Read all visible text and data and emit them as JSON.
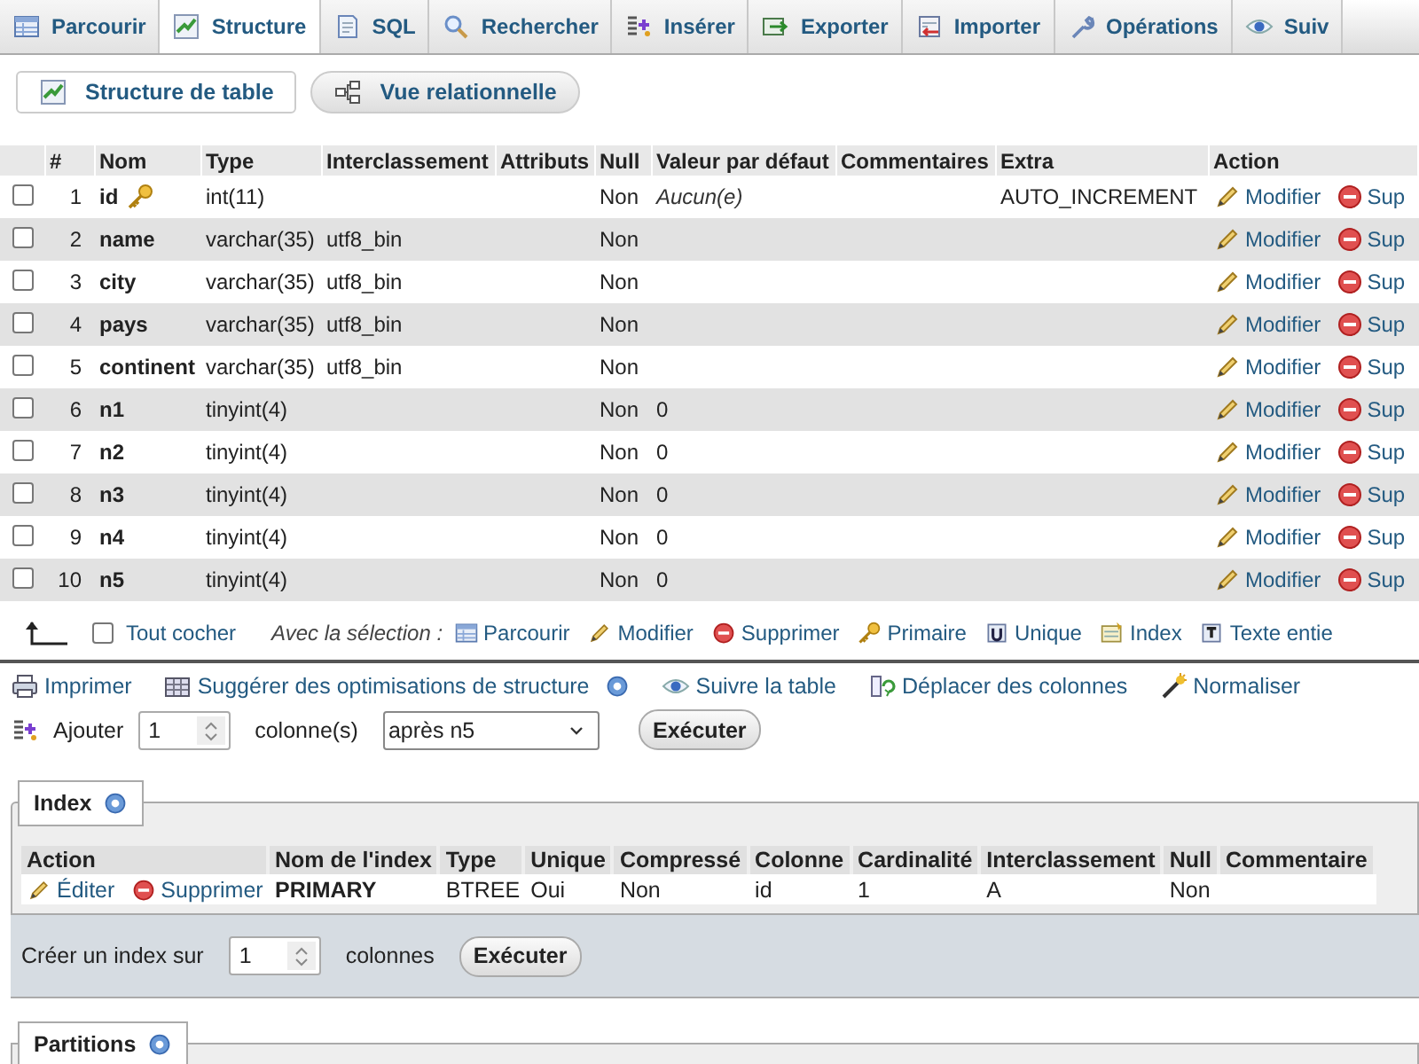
{
  "tabs": [
    {
      "label": "Parcourir",
      "kind": "browse",
      "selected": false
    },
    {
      "label": "Structure",
      "kind": "structure",
      "selected": true
    },
    {
      "label": "SQL",
      "kind": "sql",
      "selected": false
    },
    {
      "label": "Rechercher",
      "kind": "search",
      "selected": false
    },
    {
      "label": "Insérer",
      "kind": "insert",
      "selected": false
    },
    {
      "label": "Exporter",
      "kind": "export",
      "selected": false
    },
    {
      "label": "Importer",
      "kind": "import",
      "selected": false
    },
    {
      "label": "Opérations",
      "kind": "wrench",
      "selected": false
    },
    {
      "label": "Suiv",
      "kind": "eye",
      "selected": false
    }
  ],
  "subnav": [
    {
      "label": "Structure de table",
      "kind": "structure",
      "selected": true
    },
    {
      "label": "Vue relationnelle",
      "kind": "relation",
      "selected": false
    }
  ],
  "structure_table": {
    "columns": [
      "#",
      "Nom",
      "Type",
      "Interclassement",
      "Attributs",
      "Null",
      "Valeur par défaut",
      "Commentaires",
      "Extra",
      "Action"
    ],
    "rows": [
      {
        "checked": false,
        "number": "1",
        "name": "id",
        "primary": true,
        "type": "int(11)",
        "collation": "",
        "null": "Non",
        "default": "Aucun(e)",
        "default_none": true,
        "extra": "AUTO_INCREMENT",
        "actions": [
          "Modifier",
          "Sup"
        ]
      },
      {
        "checked": false,
        "number": "2",
        "name": "name",
        "primary": false,
        "type": "varchar(35)",
        "collation": "utf8_bin",
        "null": "Non",
        "default": "",
        "default_none": false,
        "extra": "",
        "actions": [
          "Modifier",
          "Sup"
        ]
      },
      {
        "checked": false,
        "number": "3",
        "name": "city",
        "primary": false,
        "type": "varchar(35)",
        "collation": "utf8_bin",
        "null": "Non",
        "default": "",
        "default_none": false,
        "extra": "",
        "actions": [
          "Modifier",
          "Sup"
        ]
      },
      {
        "checked": false,
        "number": "4",
        "name": "pays",
        "primary": false,
        "type": "varchar(35)",
        "collation": "utf8_bin",
        "null": "Non",
        "default": "",
        "default_none": false,
        "extra": "",
        "actions": [
          "Modifier",
          "Sup"
        ]
      },
      {
        "checked": false,
        "number": "5",
        "name": "continent",
        "primary": false,
        "type": "varchar(35)",
        "collation": "utf8_bin",
        "null": "Non",
        "default": "",
        "default_none": false,
        "extra": "",
        "actions": [
          "Modifier",
          "Sup"
        ]
      },
      {
        "checked": false,
        "number": "6",
        "name": "n1",
        "primary": false,
        "type": "tinyint(4)",
        "collation": "",
        "null": "Non",
        "default": "0",
        "default_none": false,
        "extra": "",
        "actions": [
          "Modifier",
          "Sup"
        ]
      },
      {
        "checked": false,
        "number": "7",
        "name": "n2",
        "primary": false,
        "type": "tinyint(4)",
        "collation": "",
        "null": "Non",
        "default": "0",
        "default_none": false,
        "extra": "",
        "actions": [
          "Modifier",
          "Sup"
        ]
      },
      {
        "checked": false,
        "number": "8",
        "name": "n3",
        "primary": false,
        "type": "tinyint(4)",
        "collation": "",
        "null": "Non",
        "default": "0",
        "default_none": false,
        "extra": "",
        "actions": [
          "Modifier",
          "Sup"
        ]
      },
      {
        "checked": false,
        "number": "9",
        "name": "n4",
        "primary": false,
        "type": "tinyint(4)",
        "collation": "",
        "null": "Non",
        "default": "0",
        "default_none": false,
        "extra": "",
        "actions": [
          "Modifier",
          "Sup"
        ]
      },
      {
        "checked": false,
        "number": "10",
        "name": "n5",
        "primary": false,
        "type": "tinyint(4)",
        "collation": "",
        "null": "Non",
        "default": "0",
        "default_none": false,
        "extra": "",
        "actions": [
          "Modifier",
          "Sup"
        ]
      }
    ]
  },
  "bulk": {
    "check_all": {
      "label": "Tout cocher",
      "checked": false
    },
    "with_selection": "Avec la sélection :",
    "actions": [
      {
        "label": "Parcourir",
        "kind": "browse"
      },
      {
        "label": "Modifier",
        "kind": "pencil"
      },
      {
        "label": "Supprimer",
        "kind": "delete"
      },
      {
        "label": "Primaire",
        "kind": "key"
      },
      {
        "label": "Unique",
        "kind": "unique"
      },
      {
        "label": "Index",
        "kind": "index"
      },
      {
        "label": "Texte entie",
        "kind": "fulltext"
      }
    ]
  },
  "toolbar": [
    {
      "label": "Imprimer",
      "kind": "print",
      "help": false
    },
    {
      "label": "Suggérer des optimisations de structure",
      "kind": "optimize",
      "help": true
    },
    {
      "label": "Suivre la table",
      "kind": "eye",
      "help": false
    },
    {
      "label": "Déplacer des colonnes",
      "kind": "move",
      "help": false
    },
    {
      "label": "Normaliser",
      "kind": "wand",
      "help": false
    }
  ],
  "add_column": {
    "label": "Ajouter",
    "count": "1",
    "unit": "colonne(s)",
    "position": "après n5",
    "button": "Exécuter"
  },
  "index": {
    "legend": "Index",
    "action_header": "Action",
    "columns": [
      "Nom de l'index",
      "Type",
      "Unique",
      "Compressé",
      "Colonne",
      "Cardinalité",
      "Interclassement",
      "Null",
      "Commentaire"
    ],
    "rows": [
      {
        "actions": [
          "Éditer",
          "Supprimer"
        ],
        "cells": [
          "PRIMARY",
          "BTREE",
          "Oui",
          "Non",
          "id",
          "1",
          "A",
          "Non"
        ]
      }
    ],
    "create": {
      "label": "Créer un index sur",
      "count": "1",
      "unit": "colonnes",
      "button": "Exécuter"
    }
  },
  "partitions": {
    "legend": "Partitions"
  }
}
